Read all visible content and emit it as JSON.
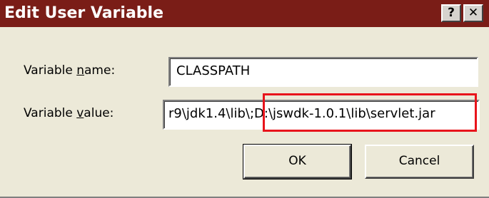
{
  "window": {
    "title": "Edit User Variable",
    "help_button": "?",
    "close_button": "✕"
  },
  "form": {
    "name_label_prefix": "Variable ",
    "name_label_mnemonic": "n",
    "name_label_suffix": "ame:",
    "name_value": "CLASSPATH",
    "value_label_prefix": "Variable ",
    "value_label_mnemonic": "v",
    "value_label_suffix": "alue:",
    "value_value": "r9\\jdk1.4\\lib\\;D:\\jswdk-1.0.1\\lib\\servlet.jar"
  },
  "buttons": {
    "ok": "OK",
    "cancel": "Cancel"
  },
  "colors": {
    "titlebar": "#7a1d17",
    "highlight": "#e8141b"
  }
}
